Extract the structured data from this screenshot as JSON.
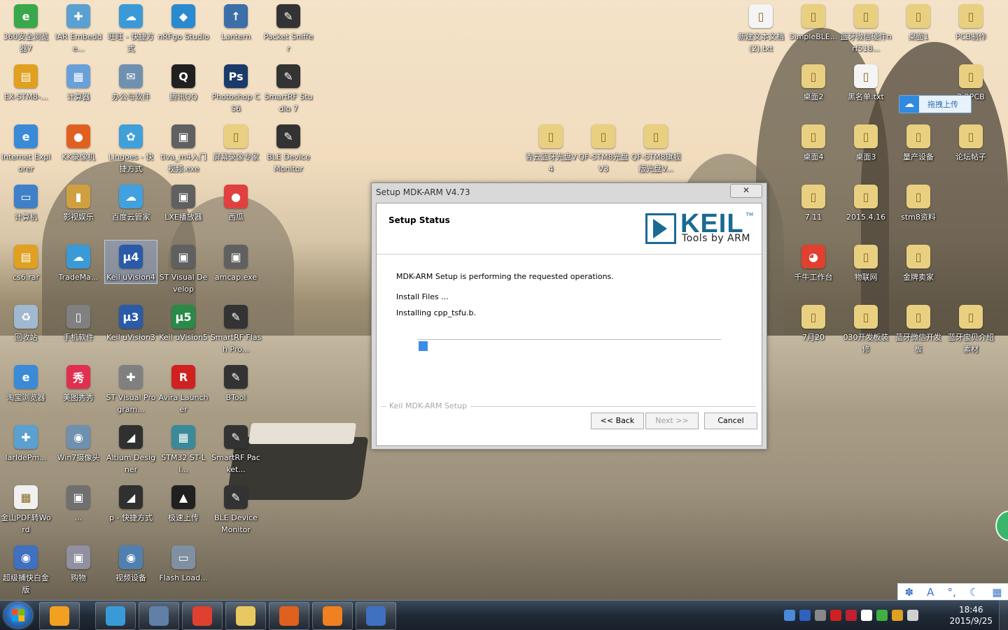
{
  "desktop": {
    "icons_left": [
      {
        "label": "360安全浏览器7",
        "glyph": "e",
        "color": "#39a84a"
      },
      {
        "label": "IAR Embedde...",
        "glyph": "✚",
        "color": "#5aa0d0"
      },
      {
        "label": "旺旺 - 快捷方式",
        "glyph": "☁",
        "color": "#3a9ad8"
      },
      {
        "label": "nRFgo Studio",
        "glyph": "◆",
        "color": "#2a8ad0"
      },
      {
        "label": "Lantern",
        "glyph": "↑",
        "color": "#3c6ea8"
      },
      {
        "label": "Packet Sniffer",
        "glyph": "✎",
        "color": "#333333"
      },
      {
        "label": "EX-STM8-...",
        "glyph": "▤",
        "color": "#e0a020"
      },
      {
        "label": "计算器",
        "glyph": "▦",
        "color": "#6aa0d8"
      },
      {
        "label": "办公与软件",
        "glyph": "✉",
        "color": "#7090b0"
      },
      {
        "label": "腾讯QQ",
        "glyph": "Q",
        "color": "#202020"
      },
      {
        "label": "Photoshop CS6",
        "glyph": "Ps",
        "color": "#1a3a6a"
      },
      {
        "label": "SmartRF Studio 7",
        "glyph": "✎",
        "color": "#333333"
      },
      {
        "label": "Internet Explorer",
        "glyph": "e",
        "color": "#3a8ad8"
      },
      {
        "label": "KK录像机",
        "glyph": "●",
        "color": "#e06020"
      },
      {
        "label": "Lingoes - 快捷方式",
        "glyph": "✿",
        "color": "#40a0d8"
      },
      {
        "label": "tiva_m4入门视频.exe",
        "glyph": "▣",
        "color": "#606060"
      },
      {
        "label": "屏幕录像专家",
        "glyph": "▯",
        "color": "#e8d080"
      },
      {
        "label": "BLE Device Monitor",
        "glyph": "✎",
        "color": "#333333"
      },
      {
        "label": "计算机",
        "glyph": "▭",
        "color": "#4080c8"
      },
      {
        "label": "影视娱乐",
        "glyph": "▮",
        "color": "#d0a040"
      },
      {
        "label": "百度云管家",
        "glyph": "☁",
        "color": "#40a0e0"
      },
      {
        "label": "LXE播放器",
        "glyph": "▣",
        "color": "#606060"
      },
      {
        "label": "西瓜",
        "glyph": "●",
        "color": "#e04040"
      },
      {
        "label": "cs6.rar",
        "glyph": "▤",
        "color": "#e0a020"
      },
      {
        "label": "TradeMa...",
        "glyph": "☁",
        "color": "#3a9ad8"
      },
      {
        "label": "Keil uVision4",
        "glyph": "μ4",
        "color": "#2a5aa8"
      },
      {
        "label": "ST Visual Develop",
        "glyph": "▣",
        "color": "#606060"
      },
      {
        "label": "amcap.exe",
        "glyph": "▣",
        "color": "#606060"
      },
      {
        "label": "回收站",
        "glyph": "♻",
        "color": "#a0b8d0"
      },
      {
        "label": "手机软件",
        "glyph": "▯",
        "color": "#808080"
      },
      {
        "label": "Keil uVision3",
        "glyph": "μ3",
        "color": "#2a5aa8"
      },
      {
        "label": "Keil uVision5",
        "glyph": "μ5",
        "color": "#2a8a48"
      },
      {
        "label": "SmartRF Flash Pro...",
        "glyph": "✎",
        "color": "#333333"
      },
      {
        "label": "淘宝浏览器",
        "glyph": "e",
        "color": "#3a8ad8"
      },
      {
        "label": "美图秀秀",
        "glyph": "秀",
        "color": "#e03050"
      },
      {
        "label": "ST Visual Program...",
        "glyph": "✚",
        "color": "#808080"
      },
      {
        "label": "Avira Launcher",
        "glyph": "R",
        "color": "#d02020"
      },
      {
        "label": "BTool",
        "glyph": "✎",
        "color": "#333333"
      },
      {
        "label": "IarIdePm...",
        "glyph": "✚",
        "color": "#5aa0d0"
      },
      {
        "label": "Win7摄像头",
        "glyph": "◉",
        "color": "#7090b0"
      },
      {
        "label": "Altium Designer",
        "glyph": "◢",
        "color": "#303030"
      },
      {
        "label": "STM32 ST-LI...",
        "glyph": "▦",
        "color": "#3a8a9a"
      },
      {
        "label": "SmartRF Packet...",
        "glyph": "✎",
        "color": "#333333"
      },
      {
        "label": "金山PDF转Word",
        "glyph": "▦",
        "color": "#f0f0f0"
      },
      {
        "label": "...",
        "glyph": "▣",
        "color": "#707070"
      },
      {
        "label": "p - 快捷方式",
        "glyph": "◢",
        "color": "#303030"
      },
      {
        "label": "极速上传",
        "glyph": "▲",
        "color": "#202020"
      },
      {
        "label": "BLE Device Monitor",
        "glyph": "✎",
        "color": "#333333"
      },
      {
        "label": "超级捕快白金版",
        "glyph": "◉",
        "color": "#4070c0"
      },
      {
        "label": "购物",
        "glyph": "▣",
        "color": "#9090a0"
      },
      {
        "label": "视频设备",
        "glyph": "◉",
        "color": "#5080b0"
      },
      {
        "label": "Flash Load...",
        "glyph": "▭",
        "color": "#8090a0"
      }
    ],
    "icons_right": [
      {
        "label": "新建文本文档 (2).txt",
        "glyph": "▯",
        "color": "#f4f4f4"
      },
      {
        "label": "SimpleBLE...",
        "glyph": "▯",
        "color": "#e8d080"
      },
      {
        "label": "蓝牙微信硬件nrf518...",
        "glyph": "▯",
        "color": "#e8d080"
      },
      {
        "label": "桌面1",
        "glyph": "▯",
        "color": "#e8d080"
      },
      {
        "label": "PCB制作",
        "glyph": "▯",
        "color": "#e8d080"
      },
      {
        "label": "桌面2",
        "glyph": "▯",
        "color": "#e8d080"
      },
      {
        "label": "黑名单.txt",
        "glyph": "▯",
        "color": "#f4f4f4"
      },
      {
        "label": "2.2PCB",
        "glyph": "▯",
        "color": "#e8d080"
      },
      {
        "label": "青云蓝牙光盘V4",
        "glyph": "▯",
        "color": "#e8d080"
      },
      {
        "label": "QF-STM8光盘V3",
        "glyph": "▯",
        "color": "#e8d080"
      },
      {
        "label": "QF-STM8旗舰版光盘V...",
        "glyph": "▯",
        "color": "#e8d080"
      },
      {
        "label": "桌面4",
        "glyph": "▯",
        "color": "#e8d080"
      },
      {
        "label": "桌面3",
        "glyph": "▯",
        "color": "#e8d080"
      },
      {
        "label": "量产设备",
        "glyph": "▯",
        "color": "#e8d080"
      },
      {
        "label": "论坛帖子",
        "glyph": "▯",
        "color": "#e8d080"
      },
      {
        "label": "7.11",
        "glyph": "▯",
        "color": "#e8d080"
      },
      {
        "label": "2015.4.16",
        "glyph": "▯",
        "color": "#e8d080"
      },
      {
        "label": "stm8资料",
        "glyph": "▯",
        "color": "#e8d080"
      },
      {
        "label": "千牛工作台",
        "glyph": "◕",
        "color": "#e04030"
      },
      {
        "label": "物联网",
        "glyph": "▯",
        "color": "#e8d080"
      },
      {
        "label": "金牌卖家",
        "glyph": "▯",
        "color": "#e8d080"
      },
      {
        "label": "7月20",
        "glyph": "▯",
        "color": "#e8d080"
      },
      {
        "label": "030开发板装修",
        "glyph": "▯",
        "color": "#e8d080"
      },
      {
        "label": "蓝牙微信开发板",
        "glyph": "▯",
        "color": "#e8d080"
      },
      {
        "label": "蓝牙宝贝介绍素材",
        "glyph": "▯",
        "color": "#e8d080"
      }
    ]
  },
  "upload_widget": {
    "label": "拖拽上传"
  },
  "dialog": {
    "title": "Setup MDK-ARM V4.73",
    "close_label": "✕",
    "header_title": "Setup Status",
    "logo_word": "KEIL",
    "logo_tm": "TM",
    "logo_sub": "Tools by ARM",
    "line1": "MDK-ARM Setup is performing the requested operations.",
    "line2": "Install Files ...",
    "line3": "Installing cpp_tsfu.b.",
    "progress": 0.03,
    "group_label": "Keil MDK-ARM Setup",
    "back_label": "<< Back",
    "next_label": "Next >>",
    "cancel_label": "Cancel"
  },
  "taskbar": {
    "clock_time": "18:46",
    "clock_date": "2015/9/25",
    "buttons": [
      {
        "name": "media-button",
        "color": "#f2a020"
      },
      {
        "name": "ie-button",
        "color": "#3a9ad8"
      },
      {
        "name": "book-button",
        "color": "#6080a8"
      },
      {
        "name": "qianniu-button",
        "color": "#e04030"
      },
      {
        "name": "explorer-button",
        "color": "#e8c860"
      },
      {
        "name": "kk-button",
        "color": "#e06020"
      },
      {
        "name": "pdf-button",
        "color": "#f08020"
      },
      {
        "name": "setup-button",
        "color": "#4070c0"
      }
    ]
  }
}
